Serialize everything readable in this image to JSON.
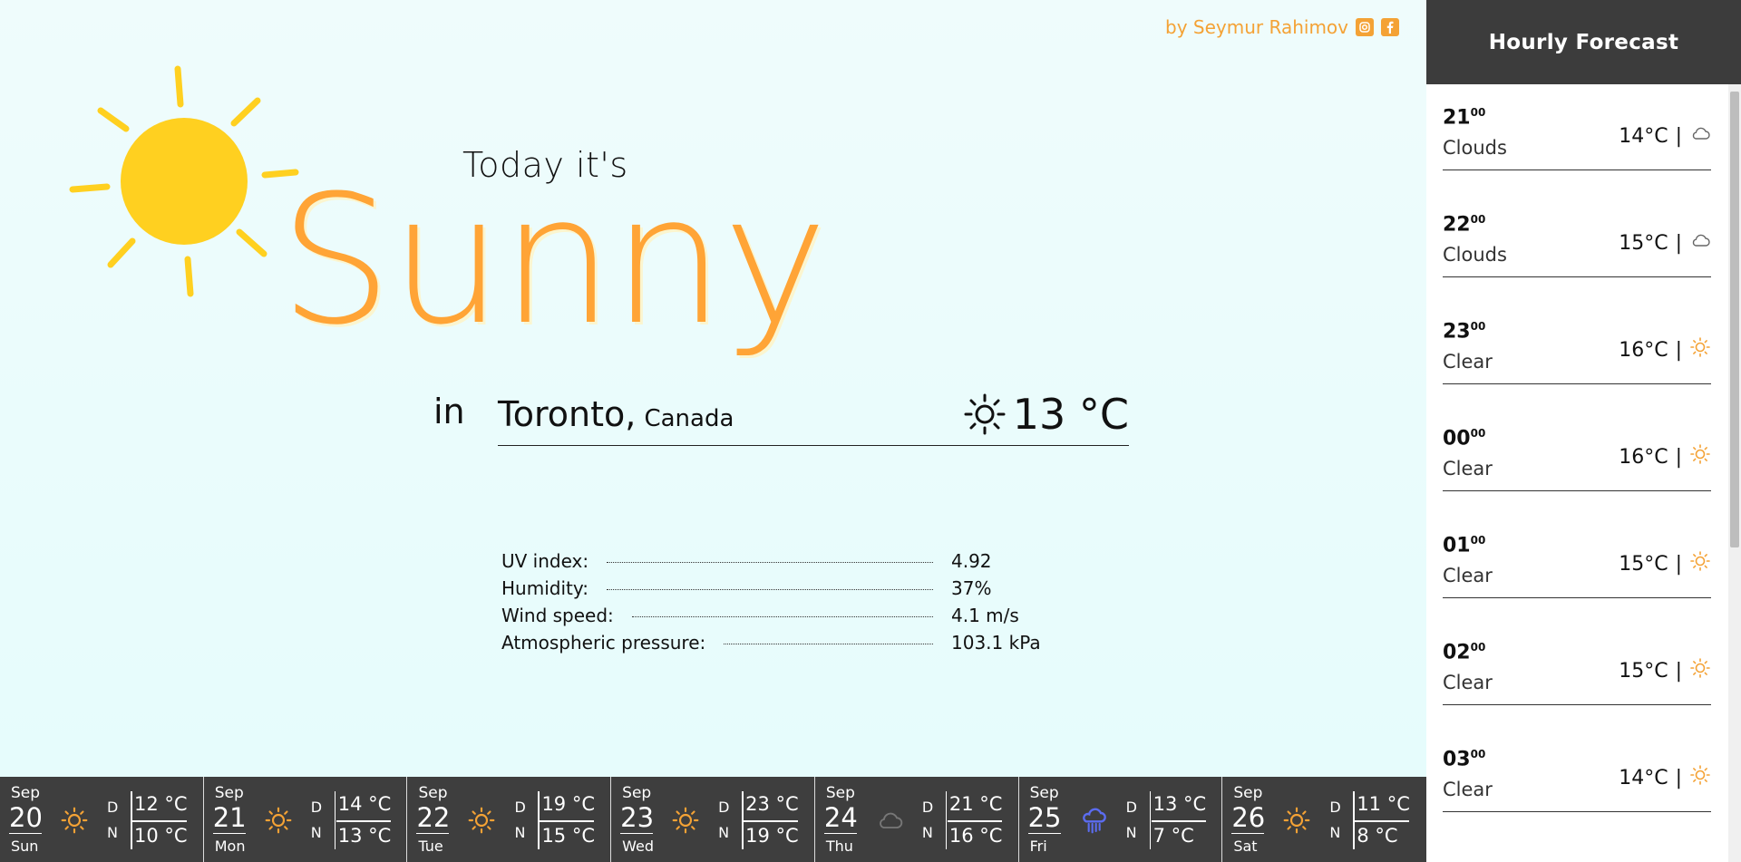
{
  "author": {
    "text": "by Seymur Rahimov"
  },
  "hero": {
    "prefix": "Today it's",
    "condition": "Sunny",
    "in": "in",
    "city": "Toronto,",
    "country": "Canada",
    "temperature": "13 °C"
  },
  "stats": [
    {
      "label": "UV index:",
      "value": "4.92"
    },
    {
      "label": "Humidity:",
      "value": "37%"
    },
    {
      "label": "Wind speed:",
      "value": "4.1 m/s"
    },
    {
      "label": "Atmospheric pressure:",
      "value": "103.1 kPa"
    }
  ],
  "sidebar": {
    "title": "Hourly Forecast",
    "hours": [
      {
        "hour": "21",
        "min": "00",
        "desc": "Clouds",
        "temp": "14°C",
        "sep": "|",
        "icon": "cloud-icon"
      },
      {
        "hour": "22",
        "min": "00",
        "desc": "Clouds",
        "temp": "15°C",
        "sep": "|",
        "icon": "cloud-icon"
      },
      {
        "hour": "23",
        "min": "00",
        "desc": "Clear",
        "temp": "16°C",
        "sep": "|",
        "icon": "sun-icon"
      },
      {
        "hour": "00",
        "min": "00",
        "desc": "Clear",
        "temp": "16°C",
        "sep": "|",
        "icon": "sun-icon"
      },
      {
        "hour": "01",
        "min": "00",
        "desc": "Clear",
        "temp": "15°C",
        "sep": "|",
        "icon": "sun-icon"
      },
      {
        "hour": "02",
        "min": "00",
        "desc": "Clear",
        "temp": "15°C",
        "sep": "|",
        "icon": "sun-icon"
      },
      {
        "hour": "03",
        "min": "00",
        "desc": "Clear",
        "temp": "14°C",
        "sep": "|",
        "icon": "sun-icon"
      }
    ]
  },
  "days": [
    {
      "month": "Sep",
      "date": "20",
      "weekday": "Sun",
      "day_label": "D",
      "night_label": "N",
      "day_temp": "12 °C",
      "night_temp": "10 °C",
      "icon": "sun-icon"
    },
    {
      "month": "Sep",
      "date": "21",
      "weekday": "Mon",
      "day_label": "D",
      "night_label": "N",
      "day_temp": "14 °C",
      "night_temp": "13 °C",
      "icon": "sun-icon"
    },
    {
      "month": "Sep",
      "date": "22",
      "weekday": "Tue",
      "day_label": "D",
      "night_label": "N",
      "day_temp": "19 °C",
      "night_temp": "15 °C",
      "icon": "sun-icon"
    },
    {
      "month": "Sep",
      "date": "23",
      "weekday": "Wed",
      "day_label": "D",
      "night_label": "N",
      "day_temp": "23 °C",
      "night_temp": "19 °C",
      "icon": "sun-icon"
    },
    {
      "month": "Sep",
      "date": "24",
      "weekday": "Thu",
      "day_label": "D",
      "night_label": "N",
      "day_temp": "21 °C",
      "night_temp": "16 °C",
      "icon": "cloud-icon"
    },
    {
      "month": "Sep",
      "date": "25",
      "weekday": "Fri",
      "day_label": "D",
      "night_label": "N",
      "day_temp": "13 °C",
      "night_temp": "7 °C",
      "icon": "rain-icon"
    },
    {
      "month": "Sep",
      "date": "26",
      "weekday": "Sat",
      "day_label": "D",
      "night_label": "N",
      "day_temp": "11 °C",
      "night_temp": "8 °C",
      "icon": "sun-icon"
    }
  ],
  "colors": {
    "accent": "#ffa436",
    "sun": "#ffd020",
    "dark_panel": "#3e3e3e",
    "rain": "#5b6cf0"
  }
}
